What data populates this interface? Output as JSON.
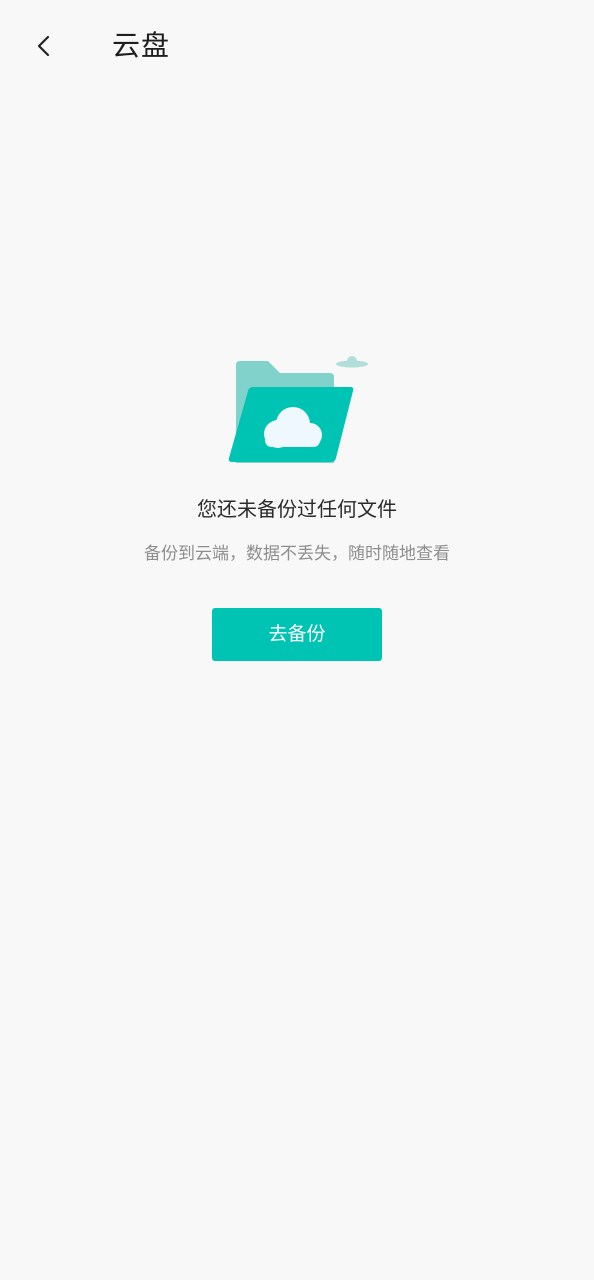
{
  "header": {
    "back_icon": "chevron-left-icon",
    "title": "云盘"
  },
  "empty_state": {
    "illustration_icon": "cloud-folder-icon",
    "title": "您还未备份过任何文件",
    "subtitle": "备份到云端，数据不丢失，随时随地查看",
    "button_label": "去备份"
  },
  "colors": {
    "background": "#f8f8f8",
    "accent": "#00c4b3",
    "folder_back": "#82d2cc",
    "folder_front": "#00c4b3",
    "cloud": "#f0f8ff",
    "title_text": "#2b2b2b",
    "subtitle_text": "#8e8e8e"
  }
}
